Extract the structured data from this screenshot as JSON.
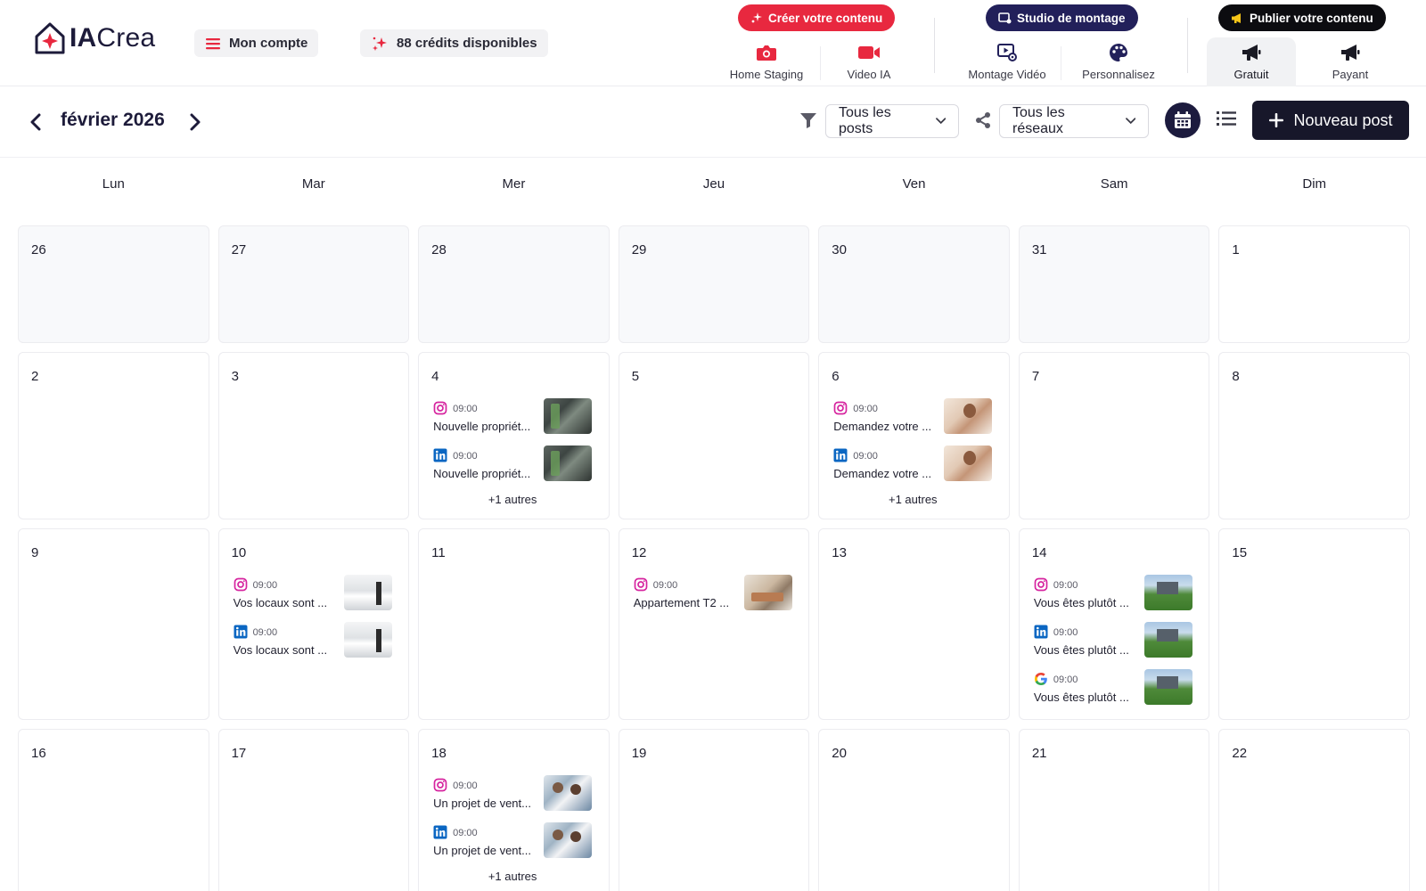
{
  "brand": {
    "logo_bold": "IA",
    "logo_light": "Crea"
  },
  "header": {
    "account_label": "Mon compte",
    "credits_label": "88 crédits disponibles",
    "groups": {
      "create": "Créer votre contenu",
      "studio": "Studio de montage",
      "publish": "Publier votre contenu"
    },
    "nav": {
      "home_staging": "Home Staging",
      "video_ia": "Video IA",
      "montage_video": "Montage Vidéo",
      "personnalisez": "Personnalisez",
      "gratuit": "Gratuit",
      "payant": "Payant"
    }
  },
  "toolbar": {
    "month_label": "février 2026",
    "posts_filter": "Tous les posts",
    "networks_filter": "Tous les réseaux",
    "new_post_label": "Nouveau post"
  },
  "calendar": {
    "weekdays": [
      "Lun",
      "Mar",
      "Mer",
      "Jeu",
      "Ven",
      "Sam",
      "Dim"
    ],
    "weeks": [
      [
        {
          "day": "26",
          "outside": true
        },
        {
          "day": "27",
          "outside": true
        },
        {
          "day": "28",
          "outside": true
        },
        {
          "day": "29",
          "outside": true
        },
        {
          "day": "30",
          "outside": true
        },
        {
          "day": "31",
          "outside": true
        },
        {
          "day": "1",
          "outside": false
        }
      ],
      [
        {
          "day": "2"
        },
        {
          "day": "3"
        },
        {
          "day": "4",
          "posts": [
            {
              "network": "instagram",
              "time": "09:00",
              "title": "Nouvelle propriét...",
              "thumb": "interior"
            },
            {
              "network": "linkedin",
              "time": "09:00",
              "title": "Nouvelle propriét...",
              "thumb": "interior"
            }
          ],
          "more": "+1 autres"
        },
        {
          "day": "5"
        },
        {
          "day": "6",
          "posts": [
            {
              "network": "instagram",
              "time": "09:00",
              "title": "Demandez votre ...",
              "thumb": "woman"
            },
            {
              "network": "linkedin",
              "time": "09:00",
              "title": "Demandez votre ...",
              "thumb": "woman"
            }
          ],
          "more": "+1 autres"
        },
        {
          "day": "7"
        },
        {
          "day": "8"
        }
      ],
      [
        {
          "day": "9"
        },
        {
          "day": "10",
          "posts": [
            {
              "network": "instagram",
              "time": "09:00",
              "title": "Vos locaux sont ...",
              "thumb": "office"
            },
            {
              "network": "linkedin",
              "time": "09:00",
              "title": "Vos locaux sont ...",
              "thumb": "office"
            }
          ]
        },
        {
          "day": "11"
        },
        {
          "day": "12",
          "posts": [
            {
              "network": "instagram",
              "time": "09:00",
              "title": "Appartement T2 ...",
              "thumb": "apartment"
            }
          ]
        },
        {
          "day": "13"
        },
        {
          "day": "14",
          "posts": [
            {
              "network": "instagram",
              "time": "09:00",
              "title": "Vous êtes plutôt ...",
              "thumb": "castle"
            },
            {
              "network": "linkedin",
              "time": "09:00",
              "title": "Vous êtes plutôt ...",
              "thumb": "castle"
            },
            {
              "network": "google",
              "time": "09:00",
              "title": "Vous êtes plutôt ...",
              "thumb": "castle"
            }
          ]
        },
        {
          "day": "15"
        }
      ],
      [
        {
          "day": "16"
        },
        {
          "day": "17"
        },
        {
          "day": "18",
          "posts": [
            {
              "network": "instagram",
              "time": "09:00",
              "title": "Un projet de vent...",
              "thumb": "meeting"
            },
            {
              "network": "linkedin",
              "time": "09:00",
              "title": "Un projet de vent...",
              "thumb": "meeting"
            }
          ],
          "more": "+1 autres"
        },
        {
          "day": "19"
        },
        {
          "day": "20"
        },
        {
          "day": "21"
        },
        {
          "day": "22"
        }
      ]
    ]
  },
  "colors": {
    "accent_red": "#e8283f",
    "studio_navy": "#22205a",
    "publish_black": "#0c0c10",
    "instagram": "#d6249f",
    "linkedin": "#0a66c2"
  }
}
